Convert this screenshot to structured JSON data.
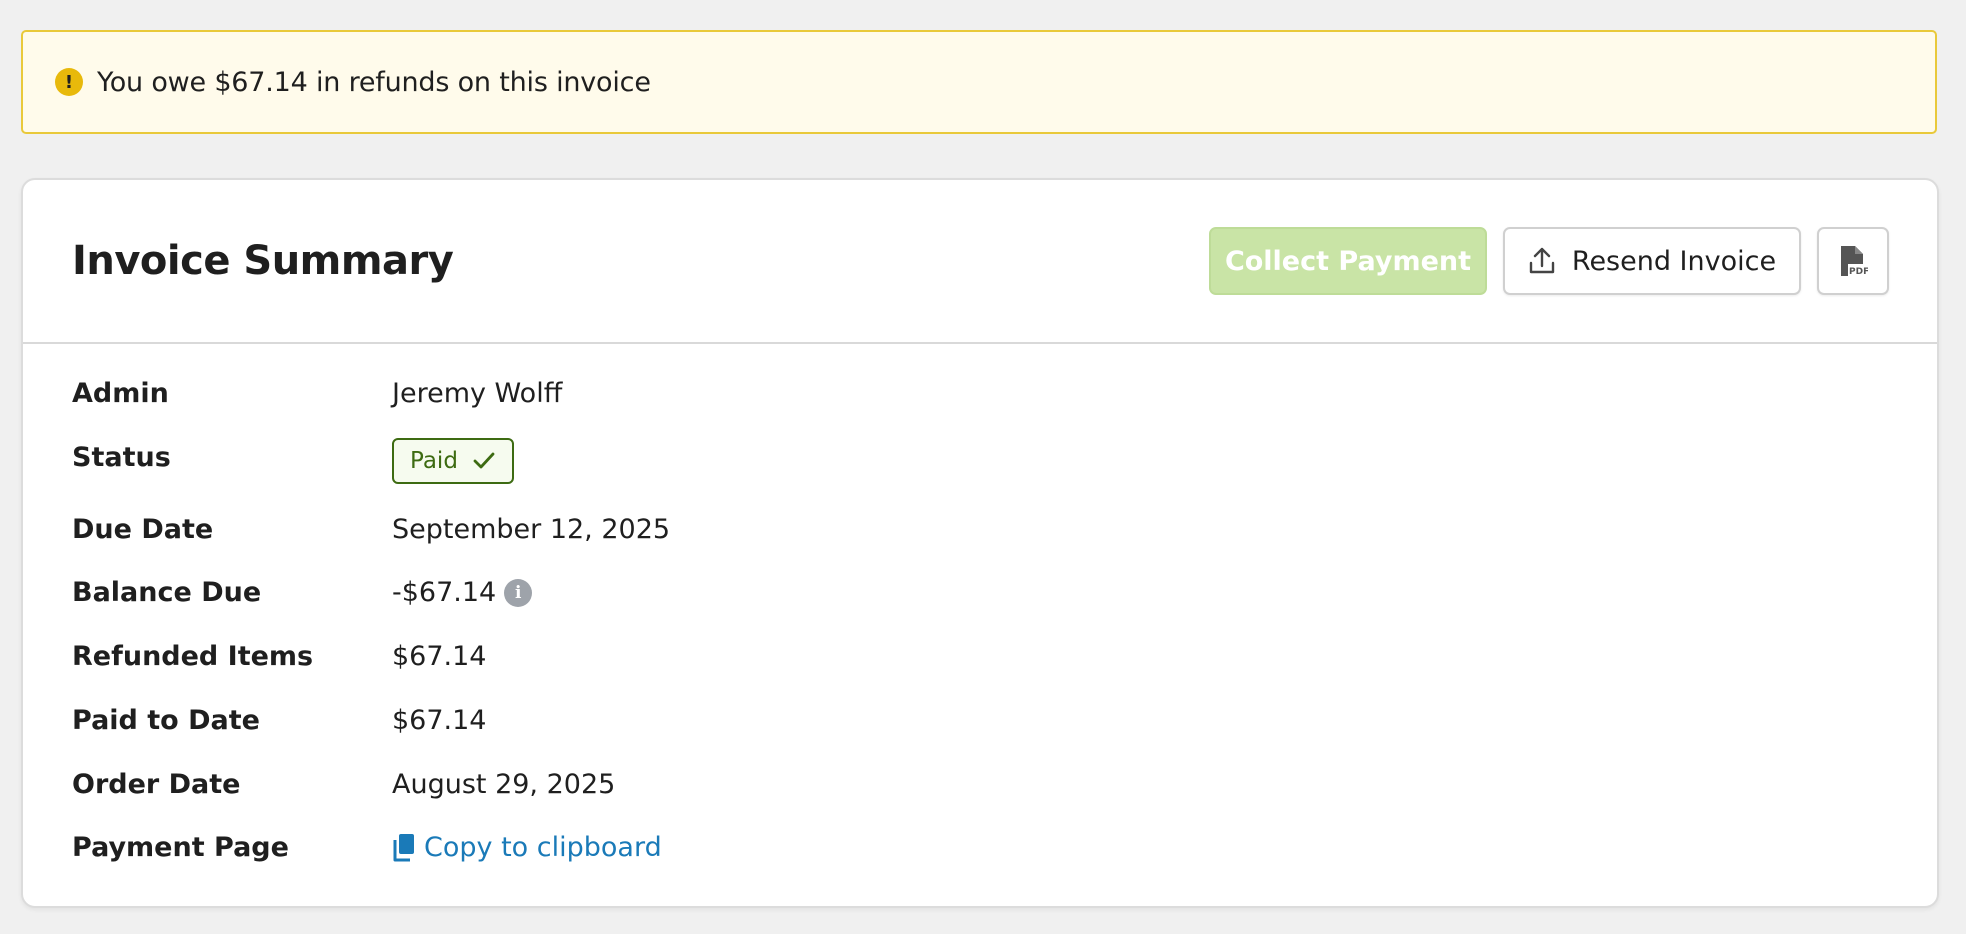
{
  "alert": {
    "icon": "exclamation-circle-icon",
    "message": "You owe $67.14 in refunds on this invoice",
    "color": "#e8b90b"
  },
  "card": {
    "title": "Invoice Summary",
    "actions": {
      "collect_label": "Collect Payment",
      "collect_color": "#c9e4a6",
      "resend_label": "Resend Invoice",
      "resend_icon": "upload-icon",
      "pdf_icon": "pdf-file-icon"
    }
  },
  "details": [
    {
      "label": "Admin",
      "value": "Jeremy Wolff"
    },
    {
      "label": "Status",
      "value": "Paid",
      "badge_color": "#3d6b12",
      "icon": "checkmark-icon"
    },
    {
      "label": "Due Date",
      "value": "September 12, 2025"
    },
    {
      "label": "Balance Due",
      "value": "-$67.14",
      "icon": "info-icon"
    },
    {
      "label": "Refunded Items",
      "value": "$67.14"
    },
    {
      "label": "Paid to Date",
      "value": "$67.14"
    },
    {
      "label": "Order Date",
      "value": "August 29, 2025"
    },
    {
      "label": "Payment Page",
      "value": "Copy to clipboard",
      "icon": "clipboard-icon",
      "link_color": "#1a7ab8"
    }
  ]
}
